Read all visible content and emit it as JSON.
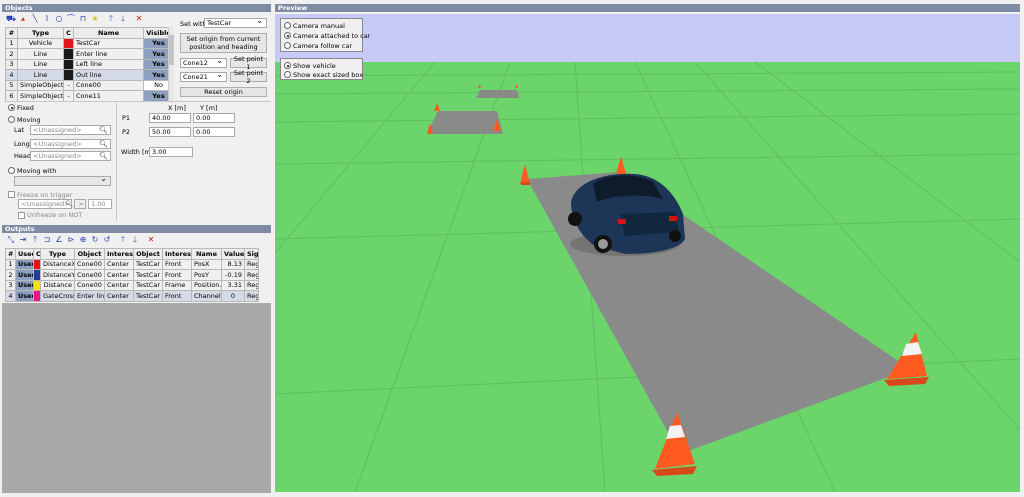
{
  "objects_panel": {
    "title": "Objects",
    "columns": [
      "#",
      "Type",
      "C",
      "Name",
      "Visible"
    ],
    "rows": [
      {
        "num": "1",
        "type": "Vehicle",
        "color": "#e0141b",
        "name": "TestCar",
        "visible": "Yes"
      },
      {
        "num": "2",
        "type": "Line",
        "color": "#1a1a1a",
        "name": "Enter line",
        "visible": "Yes"
      },
      {
        "num": "3",
        "type": "Line",
        "color": "#1a1a1a",
        "name": "Left line",
        "visible": "Yes"
      },
      {
        "num": "4",
        "type": "Line",
        "color": "#1a1a1a",
        "name": "Out line",
        "visible": "Yes"
      },
      {
        "num": "5",
        "type": "SimpleObject",
        "color": "-",
        "name": "Cone00",
        "visible": "No"
      },
      {
        "num": "6",
        "type": "SimpleObject",
        "color": "-",
        "name": "Cone11",
        "visible": "Yes"
      }
    ],
    "set_with_label": "Set with",
    "set_with_value": "TestCar",
    "set_origin_label": "Set origin from current position and heading",
    "cone_a": "Cone12",
    "set_point1": "Set point 1",
    "cone_b": "Cone21",
    "set_point2": "Set point 2",
    "reset_origin": "Reset origin",
    "fixed_label": "Fixed",
    "moving_label": "Moving",
    "lat_label": "Lat",
    "long_label": "Long",
    "head_label": "Head",
    "unassigned": "<Unassigned>",
    "moving_with_label": "Moving with",
    "freeze_label": "Freeze on trigger",
    "freeze_value": "1.00",
    "freeze_op": ">",
    "unfreeze_label": "Unfreeze on NOT",
    "x_header": "X [m]",
    "y_header": "Y [m]",
    "p1_label": "P1",
    "p1_x": "40.00",
    "p1_y": "0.00",
    "p2_label": "P2",
    "p2_x": "50.00",
    "p2_y": "0.00",
    "width_label": "Width [m]",
    "width_value": "3.00"
  },
  "outputs_panel": {
    "title": "Outputs",
    "columns": [
      "#",
      "Used",
      "C",
      "Type",
      "Object",
      "Interest",
      "Object",
      "Interest",
      "Name",
      "Value",
      "Sign"
    ],
    "rows": [
      {
        "num": "1",
        "used": "Used",
        "color": "#e0141b",
        "type": "DistanceX",
        "obj1": "Cone00",
        "int1": "Center",
        "obj2": "TestCar",
        "int2": "Front",
        "name": "PosX",
        "value": "8.13",
        "sign": "Reg."
      },
      {
        "num": "2",
        "used": "Used",
        "color": "#1c3f94",
        "type": "DistanceY",
        "obj1": "Cone00",
        "int1": "Center",
        "obj2": "TestCar",
        "int2": "Front",
        "name": "PosY",
        "value": "-0.19",
        "sign": "Reg."
      },
      {
        "num": "3",
        "used": "Used",
        "color": "#f5e400",
        "type": "Distance",
        "obj1": "Cone00",
        "int1": "Center",
        "obj2": "TestCar",
        "int2": "Frame",
        "name": "Position...",
        "value": "3.31",
        "sign": "Reg."
      },
      {
        "num": "4",
        "used": "Used",
        "color": "#e8148a",
        "type": "GateCross",
        "obj1": "Enter line",
        "int1": "Center",
        "obj2": "TestCar",
        "int2": "Front",
        "name": "Channel",
        "value": "0",
        "sign": "Reg."
      }
    ]
  },
  "preview_panel": {
    "title": "Preview",
    "camera_manual": "Camera manual",
    "camera_attached": "Camera attached to car",
    "camera_follow": "Camera follow car",
    "show_vehicle": "Show vehicle",
    "show_exact": "Show exact sized box"
  },
  "colors": {
    "header": "#7f8aa3",
    "grass": "#6bd46b",
    "sky": "#c7c9f7",
    "road": "#8a8a8a",
    "car": "#1d3557",
    "cone": "#ff5a1f"
  },
  "icons": [
    "select-tool-icon",
    "cone-tool-icon",
    "line-tool-icon",
    "polyline-tool-icon",
    "circle-tool-icon",
    "arc-tool-icon",
    "gate-tool-icon",
    "star-tool-icon",
    "move-up-icon",
    "move-down-icon",
    "delete-icon"
  ]
}
